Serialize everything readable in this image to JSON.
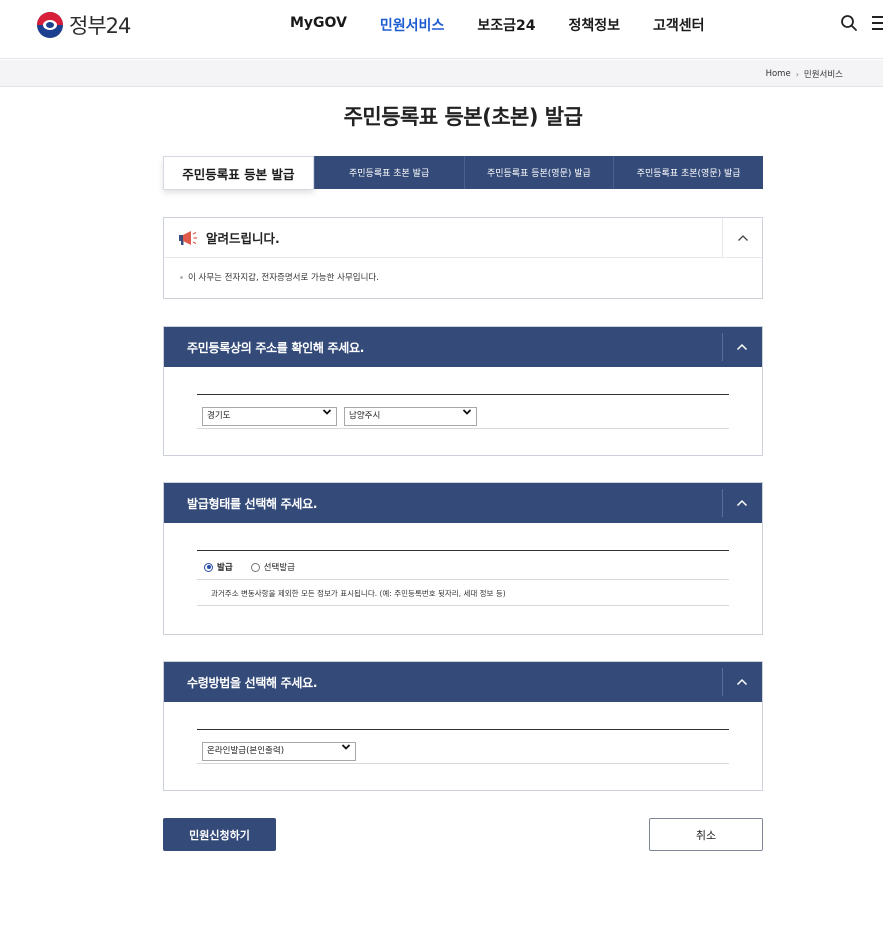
{
  "header": {
    "logo_text": "정부24",
    "nav": [
      {
        "label": "MyGOV",
        "active": false
      },
      {
        "label": "민원서비스",
        "active": true
      },
      {
        "label": "보조금24",
        "active": false
      },
      {
        "label": "정책정보",
        "active": false
      },
      {
        "label": "고객센터",
        "active": false
      }
    ],
    "icons": [
      "search-icon",
      "menu-icon"
    ]
  },
  "breadcrumb": {
    "home": "Home",
    "current": "민원서비스"
  },
  "page_title": "주민등록표 등본(초본) 발급",
  "tabs": [
    {
      "label": "주민등록표 등본 발급",
      "active": true
    },
    {
      "label": "주민등록표 초본 발급",
      "active": false
    },
    {
      "label": "주민등록표 등본(영문) 발급",
      "active": false
    },
    {
      "label": "주민등록표 초본(영문) 발급",
      "active": false
    }
  ],
  "notice": {
    "title": "알려드립니다.",
    "icon": "megaphone-icon",
    "text": "이 사무는 전자지갑, 전자증명서로 가능한 사무입니다."
  },
  "address_section": {
    "title": "주민등록상의 주소를 확인해 주세요.",
    "province_selected": "경기도",
    "city_selected": "남양주시"
  },
  "issue_type_section": {
    "title": "발급형태를 선택해 주세요.",
    "options": [
      {
        "label": "발급",
        "selected": true
      },
      {
        "label": "선택발급",
        "selected": false
      }
    ],
    "description": "과거주소 변동사항을 제외한 모든 정보가 표시됩니다. (예: 주민등록번호 뒷자리, 세대 정보 등)"
  },
  "receive_section": {
    "title": "수령방법을 선택해 주세요.",
    "method_selected": "온라인발급(본인출력)"
  },
  "actions": {
    "submit": "민원신청하기",
    "cancel": "취소"
  },
  "colors": {
    "primary_navy": "#344b7a",
    "active_nav": "#1d5bd1"
  }
}
